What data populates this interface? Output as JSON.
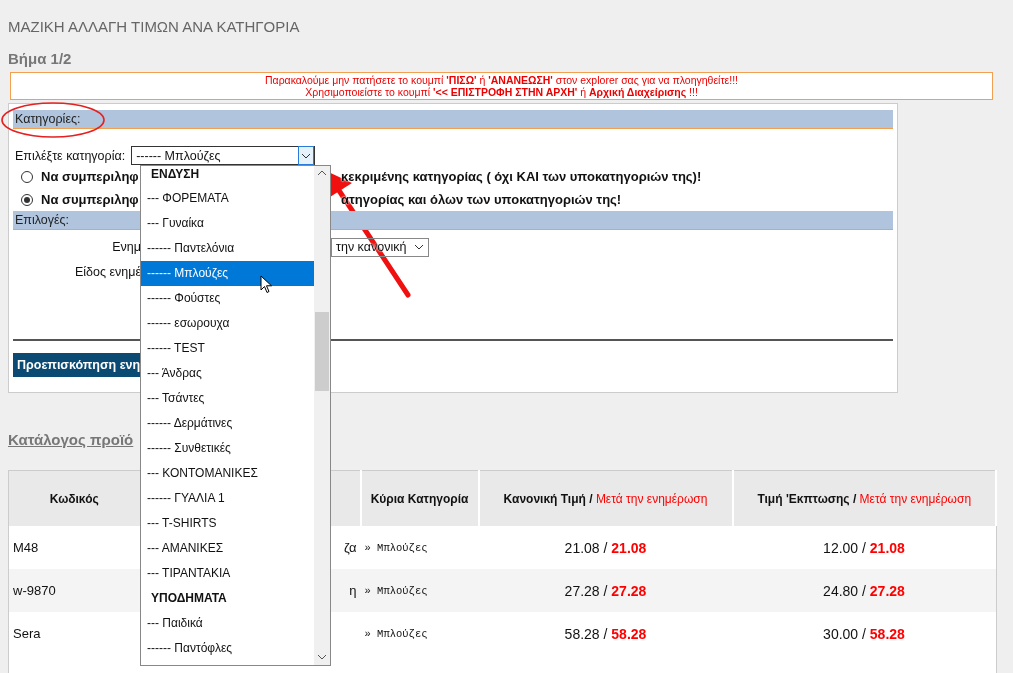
{
  "page_title": "ΜΑΖΙΚΗ ΑΛΛΑΓΗ ΤΙΜΩΝ ΑΝΑ ΚΑΤΗΓΟΡΙΑ",
  "step": "Βήμα 1/2",
  "warning": {
    "line_1": "Παρακαλούμε μην πατήσετε το κουμπί **'ΠΙΣΩ'** ή **'ΑΝΑΝΕΩΣΗ'** στον explorer σας για να πλοηγηθείτε!!!",
    "line_2": "Χρησιμοποιείστε το κουμπί **'<< ΕΠΙΣΤΡΟΦΗ ΣΤΗΝ ΑΡΧΗ'** ή **Αρχική Διαχείρισης** !!!"
  },
  "categories_panel": {
    "header": "Κατηγορίες:",
    "select_label": "Επιλέξτε κατηγορία:",
    "select_value": "------ Μπλούζες",
    "scope_options": [
      {
        "text_start": "Να συμπεριληφ",
        "text_end": "κεκριμένης κατηγορίας ( όχι ΚΑΙ των υποκατηγοριών της)!",
        "selected": false
      },
      {
        "text_start": "Να συμπεριληφ",
        "text_end": "ατηγορίας και όλων των υποκατηγοριών της!",
        "selected": true
      }
    ]
  },
  "options_panel": {
    "header": "Επιλογές:",
    "update_label": "Ενημ",
    "update_value": "την κανονική",
    "type_label": "Είδος ενημέ",
    "preview_button": "Προεπισκόπηση ενη"
  },
  "dropdown_list": {
    "items": [
      {
        "text": "ΕΝΔΥΣΗ",
        "kind": "group",
        "selected": false
      },
      {
        "text": "--- ΦΟΡΕΜΑΤΑ",
        "kind": "option",
        "selected": false
      },
      {
        "text": "--- Γυναίκα",
        "kind": "option",
        "selected": false
      },
      {
        "text": "------ Παντελόνια",
        "kind": "option",
        "selected": false
      },
      {
        "text": "------ Μπλούζες",
        "kind": "option",
        "selected": true
      },
      {
        "text": "------ Φούστες",
        "kind": "option",
        "selected": false
      },
      {
        "text": "------ εσωρουχα",
        "kind": "option",
        "selected": false
      },
      {
        "text": "------ TEST",
        "kind": "option",
        "selected": false
      },
      {
        "text": "--- Άνδρας",
        "kind": "option",
        "selected": false
      },
      {
        "text": "--- Τσάντες",
        "kind": "option",
        "selected": false
      },
      {
        "text": "------ Δερμάτινες",
        "kind": "option",
        "selected": false
      },
      {
        "text": "------ Συνθετικές",
        "kind": "option",
        "selected": false
      },
      {
        "text": "--- ΚΟΝΤΟΜΑΝΙΚΕΣ",
        "kind": "option",
        "selected": false
      },
      {
        "text": "------ ΓΥΑΛΙΑ 1",
        "kind": "option",
        "selected": false
      },
      {
        "text": "--- T-SHIRTS",
        "kind": "option",
        "selected": false
      },
      {
        "text": "--- ΑΜΑΝΙΚΕΣ",
        "kind": "option",
        "selected": false
      },
      {
        "text": "--- ΤΙΡΑΝΤΑΚΙΑ",
        "kind": "option",
        "selected": false
      },
      {
        "text": "ΥΠΟΔΗΜΑΤΑ",
        "kind": "group",
        "selected": false
      },
      {
        "text": "--- Παιδικά",
        "kind": "option",
        "selected": false
      },
      {
        "text": "------ Παντόφλες",
        "kind": "option",
        "selected": false
      }
    ]
  },
  "catalog_link": "Κατάλογος προϊό",
  "table": {
    "columns": [
      {
        "kind": "plain",
        "label": "Κωδικός"
      },
      {
        "kind": "covered"
      },
      {
        "kind": "plain",
        "label": "Κύρια Κατηγορία"
      },
      {
        "kind": "split",
        "label": "Κανονική Τιμή /",
        "after_label": "Μετά την ενημέρωση"
      },
      {
        "kind": "split",
        "label": "Τιμή 'Εκπτωσης /",
        "after_label": "Μετά την ενημέρωση"
      }
    ],
    "rows": [
      {
        "code": "M48",
        "column_2": "ζα",
        "main_category": "» Μπλούζες",
        "price": "21.08 /",
        "price_after": "21.08",
        "discount": "12.00 /",
        "discount_after": "21.08"
      },
      {
        "code": "w-9870",
        "column_2": "η",
        "main_category": "» Μπλούζες",
        "price": "27.28 /",
        "price_after": "27.28",
        "discount": "24.80 /",
        "discount_after": "27.28"
      },
      {
        "code": "Sera",
        "main_category": "» Μπλούζες",
        "price": "58.28 /",
        "price_after": "58.28",
        "discount": "30.00 /",
        "discount_after": "58.28"
      }
    ]
  }
}
